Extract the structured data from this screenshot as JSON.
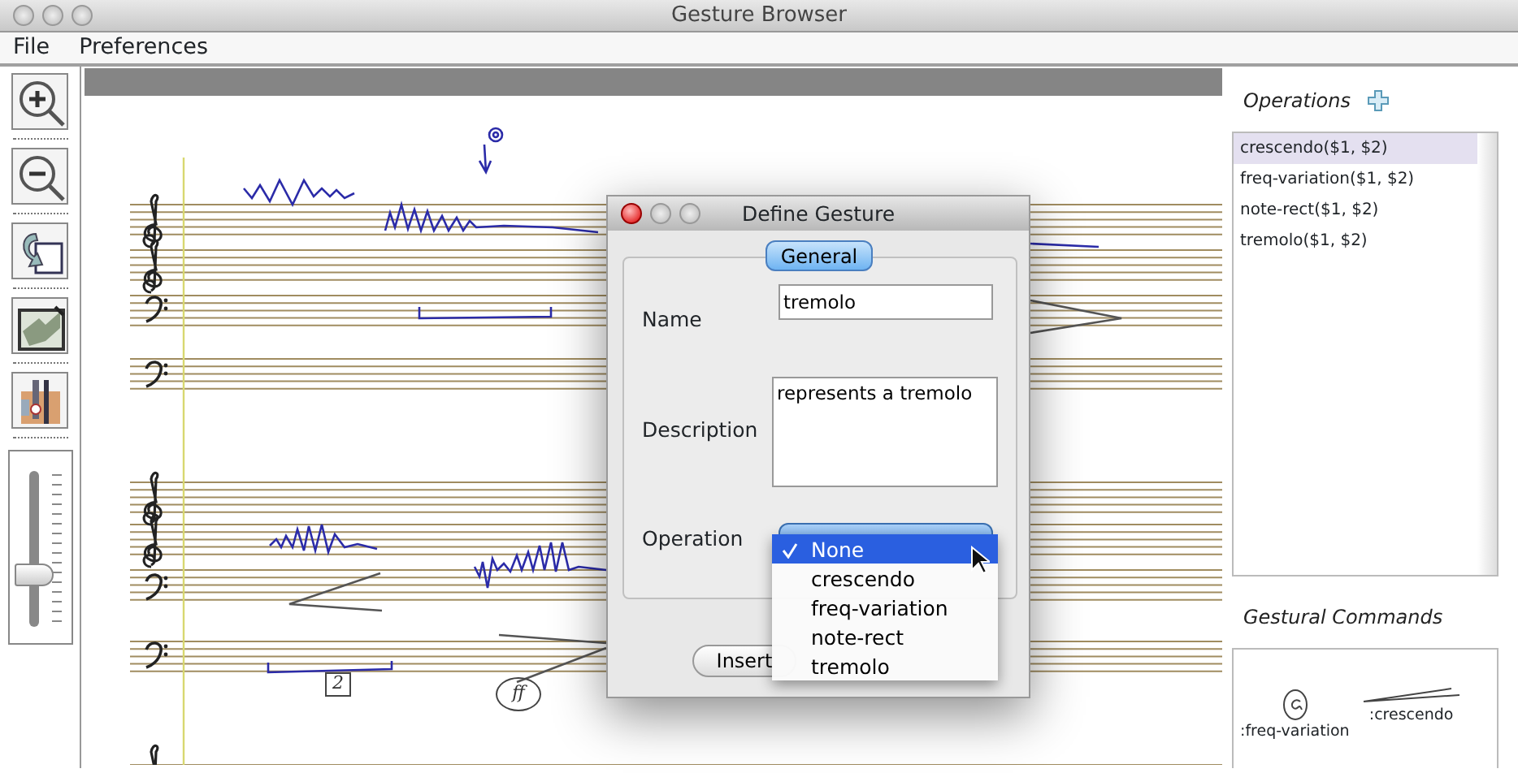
{
  "window": {
    "title": "Gesture Browser"
  },
  "menu": [
    "File",
    "Preferences"
  ],
  "toolbar": [
    {
      "kind": "zoom-in"
    },
    {
      "kind": "zoom-out"
    },
    {
      "kind": "back"
    },
    {
      "kind": "picture"
    },
    {
      "kind": "tool"
    }
  ],
  "zoom_slider": {
    "level": 0.33
  },
  "score": {
    "annotations": [
      {
        "kind": "boxed",
        "text": "2"
      },
      {
        "kind": "circled",
        "text": "ff"
      }
    ]
  },
  "operations": {
    "title": "Operations",
    "items": [
      {
        "label": "crescendo($1, $2)",
        "selected": true
      },
      {
        "label": "freq-variation($1, $2)",
        "selected": false
      },
      {
        "label": "note-rect($1, $2)",
        "selected": false
      },
      {
        "label": "tremolo($1, $2)",
        "selected": false
      }
    ]
  },
  "gestural_commands": {
    "title": "Gestural Commands",
    "items": [
      {
        "label": ":freq-variation",
        "kind": "circle"
      },
      {
        "label": ":crescendo",
        "kind": "hairpin"
      }
    ]
  },
  "dialog": {
    "title": "Define Gesture",
    "tab": "General",
    "fields": [
      {
        "kind": "text",
        "label": "Name",
        "value": "tremolo"
      },
      {
        "kind": "textarea",
        "label": "Description",
        "value": "represents a tremolo"
      },
      {
        "kind": "select",
        "label": "Operation"
      }
    ],
    "buttons": [
      "Insert"
    ],
    "dropdown": [
      {
        "label": "None",
        "selected": true
      },
      {
        "label": "crescendo",
        "selected": false
      },
      {
        "label": "freq-variation",
        "selected": false
      },
      {
        "label": "note-rect",
        "selected": false
      },
      {
        "label": "tremolo",
        "selected": false
      }
    ]
  }
}
